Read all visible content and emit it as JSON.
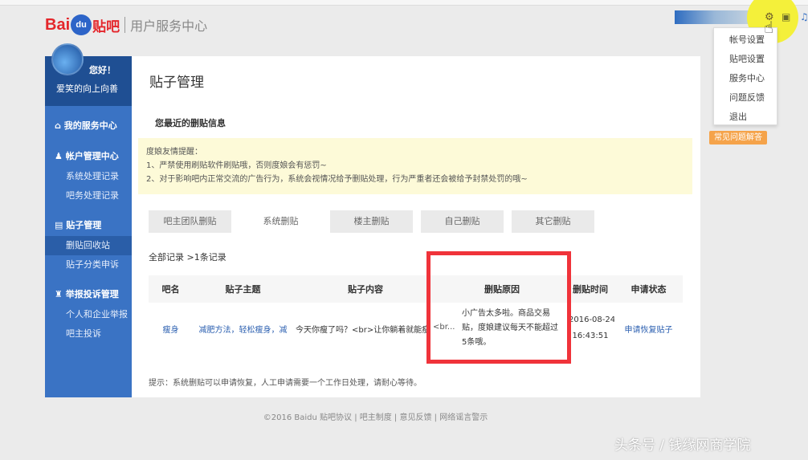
{
  "header": {
    "logo_text": "Bai",
    "logo_paw": "du",
    "logo_tieba": "贴吧",
    "subtitle": "用户服务中心"
  },
  "sidebar": {
    "greeting": "您好！",
    "username": "爱笑的向上向善",
    "groups": [
      {
        "label": "我的服务中心",
        "icon": "home-icon",
        "items": []
      },
      {
        "label": "帐户管理中心",
        "icon": "user-icon",
        "items": [
          "系统处理记录",
          "吧务处理记录"
        ]
      },
      {
        "label": "贴子管理",
        "icon": "post-icon",
        "items": [
          "删贴回收站",
          "贴子分类申诉"
        ]
      },
      {
        "label": "举报投诉管理",
        "icon": "report-icon",
        "items": [
          "个人和企业举报",
          "吧主投诉"
        ]
      }
    ],
    "active_item": "删贴回收站"
  },
  "main": {
    "title": "贴子管理",
    "section": "您最近的删贴信息",
    "warning": [
      "度娘友情提醒：",
      "1、严禁使用刷贴软件刷贴哦，否则度娘会有惩罚~",
      "2、对于影响吧内正常交流的广告行为，系统会视情况给予删贴处理，行为严重者还会被给予封禁处罚的哦~"
    ],
    "tabs": [
      "吧主团队删贴",
      "系统删贴",
      "楼主删贴",
      "自己删贴",
      "其它删贴"
    ],
    "active_tab": "系统删贴",
    "count": "全部记录 >1条记录",
    "columns": [
      "吧名",
      "贴子主题",
      "贴子内容",
      "删贴原因",
      "删贴时间",
      "申请状态"
    ],
    "rows": [
      {
        "forum": "瘦身",
        "topic": "减肥方法，轻松瘦身，减",
        "content": "今天你瘦了吗？<br>让你躺着就能瘦",
        "content_more": "<br...",
        "reason": "小广告太多啦。商品交易贴，度娘建议每天不能超过5条哦。",
        "date": "2016-08-24",
        "time": "16:43:51",
        "status": "申请恢复贴子"
      }
    ],
    "tip": "提示：系统删贴可以申请恢复，人工申请需要一个工作日处理，请耐心等待。"
  },
  "footer": "©2016 Baidu 贴吧协议 | 吧主制度 | 意见反馈 | 网络谣言警示",
  "menu": {
    "items": [
      "帐号设置",
      "贴吧设置",
      "服务中心",
      "问题反馈",
      "退出"
    ]
  },
  "faq_button": "常见问题解答",
  "watermark": "头条号 / 钱缘网商学院"
}
